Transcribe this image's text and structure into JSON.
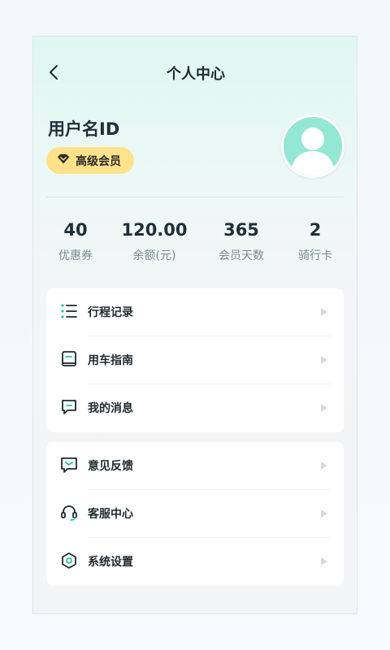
{
  "header": {
    "title": "个人中心"
  },
  "profile": {
    "username": "用户名ID",
    "badge": "高级会员"
  },
  "stats": [
    {
      "value": "40",
      "label": "优惠券"
    },
    {
      "value": "120.00",
      "label": "余额(元)"
    },
    {
      "value": "365",
      "label": "会员天数"
    },
    {
      "value": "2",
      "label": "骑行卡"
    }
  ],
  "menu1": [
    {
      "label": "行程记录",
      "icon": "list-icon"
    },
    {
      "label": "用车指南",
      "icon": "book-icon"
    },
    {
      "label": "我的消息",
      "icon": "message-icon"
    }
  ],
  "menu2": [
    {
      "label": "意见反馈",
      "icon": "feedback-icon"
    },
    {
      "label": "客服中心",
      "icon": "headset-icon"
    },
    {
      "label": "系统设置",
      "icon": "settings-icon"
    }
  ],
  "colors": {
    "accent": "#2bc4a4",
    "badge": "#ffe28a",
    "avatar": "#94e7d4"
  }
}
